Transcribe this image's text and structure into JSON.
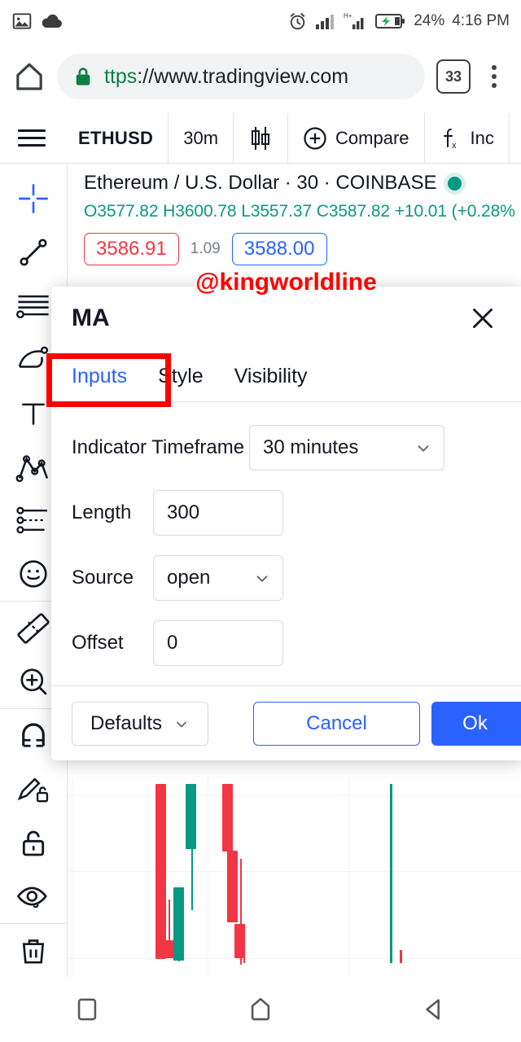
{
  "status_bar": {
    "icons_left": [
      "image-icon",
      "cloud-icon"
    ],
    "icons_right": [
      "alarm-clock-icon",
      "signal-bars-icon",
      "hplus-signal-icon",
      "battery-charging-icon"
    ],
    "battery_percent": "24%",
    "time": "4:16 PM"
  },
  "browser": {
    "home_icon": "home-icon",
    "lock_icon": "lock-icon",
    "url_scheme": "ttps",
    "url_rest": "://www.tradingview.com",
    "tab_count": "33",
    "menu_icon": "kebab-menu-icon"
  },
  "tv_toolbar": {
    "menu_icon": "hamburger-icon",
    "symbol": "ETHUSD",
    "interval": "30m",
    "chart_type_icon": "candlestick-icon",
    "compare_label": "Compare",
    "compare_icon": "plus-circle-icon",
    "indicators_label": "Inc",
    "indicators_icon": "fx-icon"
  },
  "left_tools": [
    {
      "name": "crosshair-tool",
      "active": true
    },
    {
      "name": "trend-line-tool",
      "active": false
    },
    {
      "name": "horizontal-lines-tool",
      "active": false
    },
    {
      "name": "pitchfork-tool",
      "active": false
    },
    {
      "name": "text-tool",
      "active": false
    },
    {
      "name": "pattern-tool",
      "active": false
    },
    {
      "name": "prediction-tool",
      "active": false
    },
    {
      "name": "emoji-tool",
      "active": false
    },
    {
      "name": "measure-tool",
      "active": false
    },
    {
      "name": "zoom-in-tool",
      "active": false
    },
    {
      "name": "magnet-tool",
      "active": false
    },
    {
      "name": "drawing-mode-lock-tool",
      "active": false
    },
    {
      "name": "lock-drawings-tool",
      "active": false
    },
    {
      "name": "hide-drawings-tool",
      "active": false
    },
    {
      "name": "remove-drawings-tool",
      "active": false
    }
  ],
  "chart_legend": {
    "title": "Ethereum / U.S. Dollar · 30 · COINBASE",
    "status_dot": "market-open-dot",
    "ohlc": "O3577.82 H3600.78 L3557.37 C3587.82 +10.01 (+0.28%",
    "bid": "3586.91",
    "spread": "1.09",
    "ask": "3588.00"
  },
  "dialog": {
    "title": "MA",
    "watermark": "@kingworldline",
    "close_icon": "close-icon",
    "tabs": [
      {
        "label": "Inputs",
        "active": true
      },
      {
        "label": "Style",
        "active": false
      },
      {
        "label": "Visibility",
        "active": false
      }
    ],
    "fields": {
      "timeframe_label": "Indicator Timeframe",
      "timeframe_value": "30 minutes",
      "length_label": "Length",
      "length_value": "300",
      "source_label": "Source",
      "source_value": "open",
      "offset_label": "Offset",
      "offset_value": "0"
    },
    "footer": {
      "defaults_label": "Defaults",
      "cancel_label": "Cancel",
      "ok_label": "Ok"
    },
    "annotation_color": "#ff0000"
  },
  "nav_bar": {
    "recents_icon": "square-recents-icon",
    "home_icon": "home-pentagon-icon",
    "back_icon": "back-triangle-icon"
  },
  "colors": {
    "accent_blue": "#2962ff",
    "up_green": "#089981",
    "down_red": "#f23645",
    "annotation_red": "#ff0000"
  },
  "chart_data": {
    "type": "candlestick",
    "symbol": "ETHUSD",
    "exchange": "COINBASE",
    "interval": "30",
    "open": 3577.82,
    "high": 3600.78,
    "low": 3557.37,
    "close": 3587.82,
    "change": 10.01,
    "change_percent": 0.28,
    "bid": 3586.91,
    "ask": 3588.0,
    "spread": 1.09
  }
}
